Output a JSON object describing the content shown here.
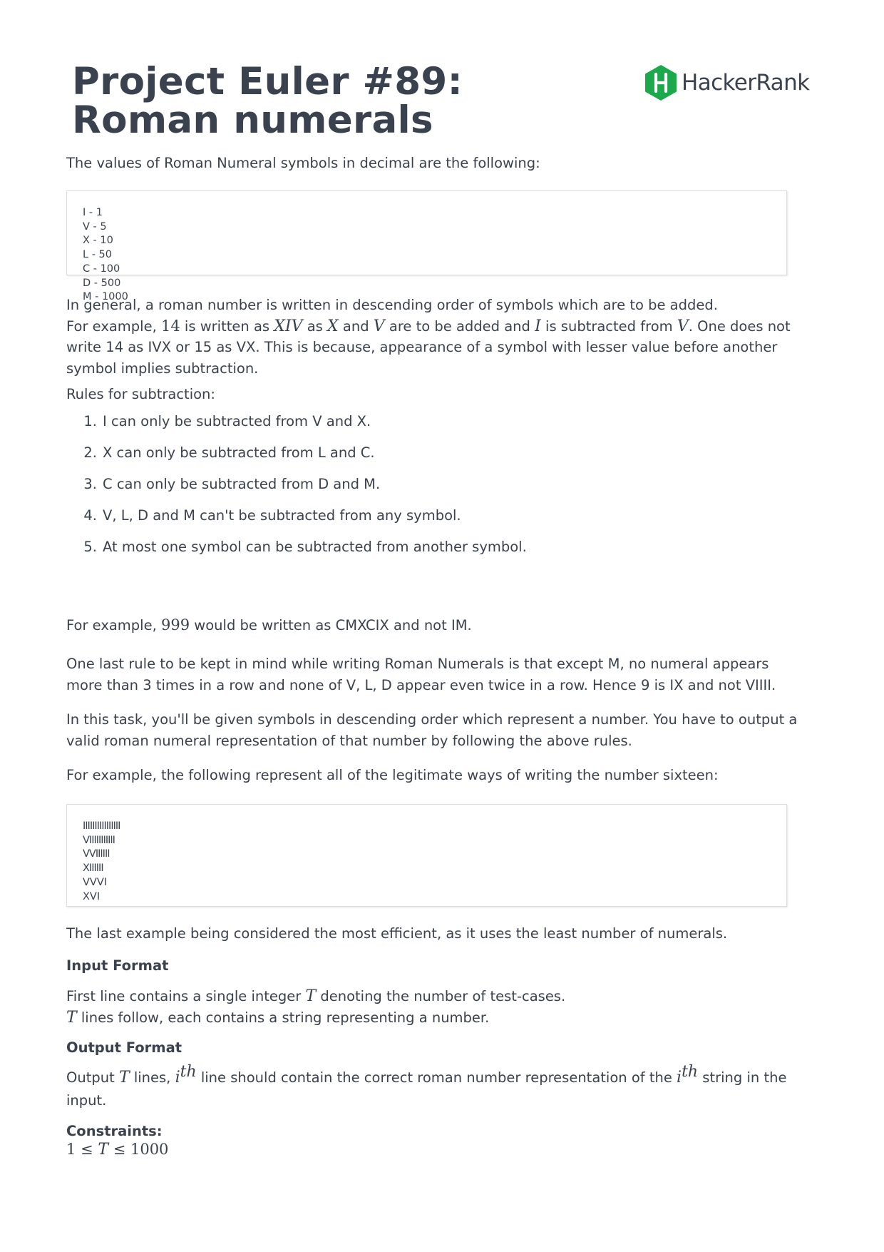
{
  "header": {
    "title_line1": "Project Euler #89:",
    "title_line2": "Roman numerals",
    "logo_text": "HackerRank",
    "logo_color": "#1ba94c"
  },
  "intro": "The values of Roman Numeral symbols in decimal are the following:",
  "symbols_block": [
    "I - 1",
    "V - 5",
    "X - 10",
    "L - 50",
    "C - 100",
    "D - 500",
    "M - 1000"
  ],
  "general": {
    "line1": "In general, a roman number is written in descending order of symbols which are to be added.",
    "p1": "For example, ",
    "m14": "14",
    "p2": " is written as ",
    "mXIV": "XIV",
    "p3": " as ",
    "mX": "X",
    "p4": " and ",
    "mV": "V",
    "p5": " are to be added and ",
    "mI": "I",
    "p6": " is subtracted from ",
    "mV2": "V",
    "p7": ". One does not write 14 as IVX or 15 as VX. This is because, appearance of a symbol with lesser value before another symbol implies subtraction."
  },
  "rules_heading": "Rules for subtraction:",
  "rules": [
    {
      "num": "1.",
      "text": "I can only be subtracted from V and X."
    },
    {
      "num": "2.",
      "text": "X can only be subtracted from L and C."
    },
    {
      "num": "3.",
      "text": "C can only be subtracted from D and M."
    },
    {
      "num": "4.",
      "text": "V, L, D and M can't be subtracted from any symbol."
    },
    {
      "num": "5.",
      "text": "At most one symbol can be subtracted from another symbol."
    }
  ],
  "example999": {
    "p1": "For example, ",
    "m": "999",
    "p2": " would be written as CMXCIX and not IM."
  },
  "last_rule": "One last rule to be kept in mind while writing Roman Numerals is that except M, no numeral appears more than 3 times in a row and none of V, L, D appear even twice in a row. Hence 9 is IX and not VIIII.",
  "task": "In this task, you'll be given symbols in descending order which represent a number. You have to output a valid roman numeral representation of that number by following the above rules.",
  "sixteen_intro": "For example, the following represent all of the legitimate ways of writing the number sixteen:",
  "sixteen_block": [
    "IIIIIIIIIIIIIIII",
    "VIIIIIIIIIII",
    "VVIIIIII",
    "XIIIIII",
    "VVVI",
    "XVI"
  ],
  "efficient": "The last example being considered the most efficient, as it uses the least number of numerals.",
  "input_format": {
    "heading": "Input Format",
    "l1a": "First line contains a single integer ",
    "mT": "T",
    "l1b": " denoting the number of test-cases.",
    "mT2": "T",
    "l2b": " lines follow, each contains a string representing a number."
  },
  "output_format": {
    "heading": "Output Format",
    "a": "Output ",
    "mT": "T",
    "b": " lines, ",
    "i1": "i",
    "s1": "th",
    "c": " line should contain the correct roman number representation of the ",
    "i2": "i",
    "s2": "th",
    "d": " string in the input."
  },
  "constraints": {
    "heading": "Constraints:",
    "c1": "1",
    "le1": " ≤ ",
    "T": "T",
    "le2": " ≤ ",
    "c2": "1000"
  }
}
